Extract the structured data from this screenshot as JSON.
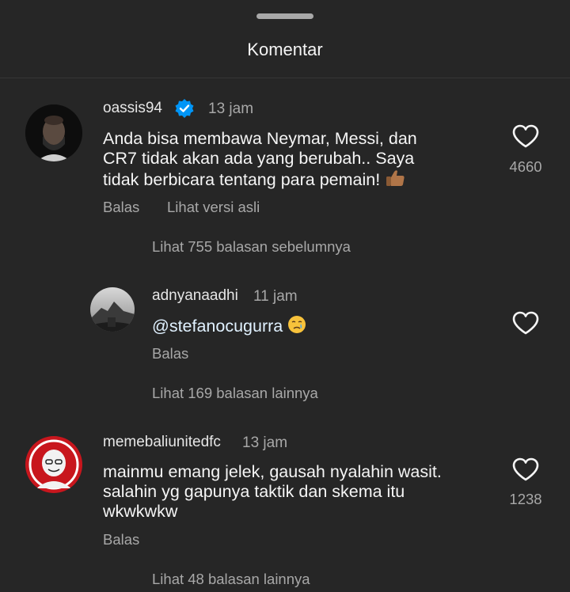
{
  "header": {
    "title": "Komentar"
  },
  "comments": [
    {
      "username": "oassis94",
      "verified": true,
      "time": "13 jam",
      "text_line1": "Anda bisa membawa Neymar, Messi, dan",
      "text_line2": "CR7 tidak akan ada yang berubah.. Saya",
      "text_line3": "tidak berbicara tentang para pemain!",
      "emoji_icon": "thumbs-up-icon",
      "likes": "4660",
      "reply_label": "Balas",
      "translate_label": "Lihat versi asli",
      "view_replies": "Lihat 755 balasan sebelumnya"
    },
    {
      "username": "adnyanaadhi",
      "time": "11 jam",
      "mention": "@stefanocugurra",
      "emoji_icon": "crying-face-icon",
      "reply_label": "Balas",
      "view_replies": "Lihat 169 balasan lainnya"
    },
    {
      "username": "memebaliunitedfc",
      "time": "13 jam",
      "text_line1": "mainmu emang jelek, gausah nyalahin wasit.",
      "text_line2": "salahin yg gapunya taktik dan skema itu",
      "text_line3": "wkwkwkw",
      "likes": "1238",
      "reply_label": "Balas",
      "view_replies": "Lihat 48 balasan lainnya"
    }
  ],
  "colors": {
    "background": "#262626",
    "primary_text": "#f5f5f5",
    "secondary_text": "#a8a8a8",
    "verified_blue": "#0095f6"
  }
}
